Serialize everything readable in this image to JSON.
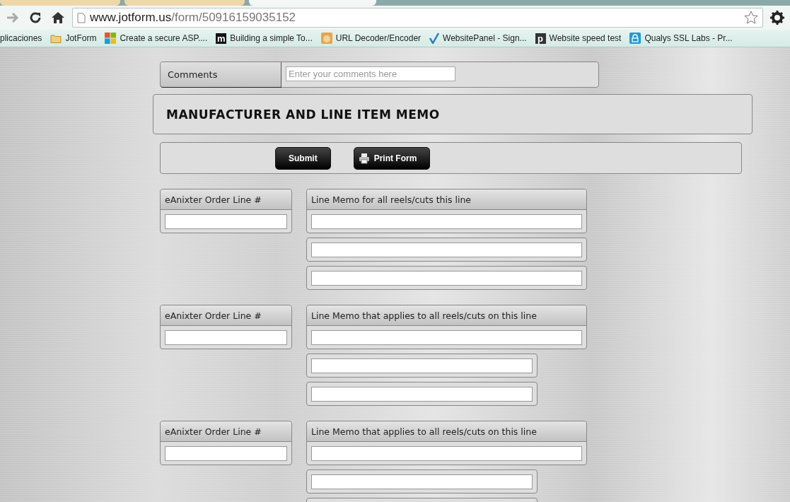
{
  "browser": {
    "url_host": "www.jotform.us",
    "url_path": "/form/50916159035152",
    "bookmarks": [
      {
        "label": "plicaciones",
        "kind": "apps"
      },
      {
        "label": "JotForm",
        "kind": "folder"
      },
      {
        "label": "Create a secure ASP....",
        "kind": "windows"
      },
      {
        "label": "Building a simple To...",
        "kind": "m"
      },
      {
        "label": "URL Decoder/Encoder",
        "kind": "face"
      },
      {
        "label": "WebsitePanel - Sign...",
        "kind": "check"
      },
      {
        "label": "Website speed test",
        "kind": "p"
      },
      {
        "label": "Qualys SSL Labs - Pr...",
        "kind": "lock"
      }
    ]
  },
  "comments": {
    "label": "Comments",
    "placeholder": "Enter your comments here"
  },
  "heading": "MANUFACTURER AND LINE ITEM MEMO",
  "buttons": [
    {
      "label": "Submit",
      "kind": "plain"
    },
    {
      "label": "Print Form",
      "kind": "print"
    }
  ],
  "groups": [
    {
      "order_label": "eAnixter Order Line #",
      "memo_label": "Line Memo for all reels/cuts this line",
      "extra_fields": [
        {
          "kind": "wide"
        },
        {
          "kind": "wide"
        }
      ]
    },
    {
      "order_label": "eAnixter Order Line #",
      "memo_label": "Line Memo that applies to all reels/cuts on this line",
      "extra_fields": [
        {
          "kind": "narrow"
        },
        {
          "kind": "narrow"
        }
      ]
    },
    {
      "order_label": "eAnixter Order Line #",
      "memo_label": "Line Memo that applies to all reels/cuts on this line",
      "extra_fields": [
        {
          "kind": "narrow"
        },
        {
          "kind": "cut"
        }
      ]
    }
  ],
  "tabs": [
    {
      "selected": false
    },
    {
      "selected": false
    },
    {
      "selected": true
    }
  ]
}
